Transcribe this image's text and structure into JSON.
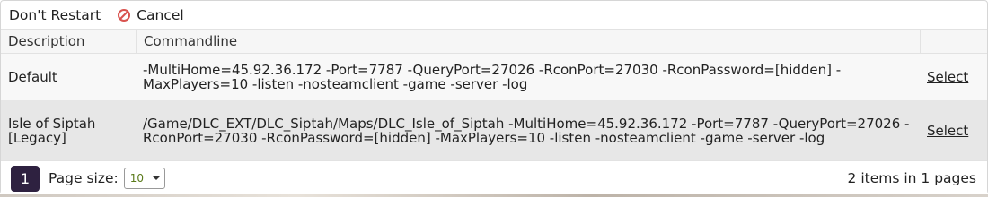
{
  "toolbar": {
    "dont_restart_label": "Don't Restart",
    "cancel_label": "Cancel"
  },
  "table": {
    "headers": [
      "Description",
      "Commandline",
      ""
    ],
    "rows": [
      {
        "description": "Default",
        "commandline": "-MultiHome=45.92.36.172 -Port=7787 -QueryPort=27026 -RconPort=27030 -RconPassword=[hidden] -MaxPlayers=10 -listen -nosteamclient -game -server -log",
        "action": "Select"
      },
      {
        "description": "Isle of Siptah [Legacy]",
        "commandline": "/Game/DLC_EXT/DLC_Siptah/Maps/DLC_Isle_of_Siptah -MultiHome=45.92.36.172 -Port=7787 -QueryPort=27026 -RconPort=27030 -RconPassword=[hidden] -MaxPlayers=10 -listen -nosteamclient -game -server -log",
        "action": "Select"
      }
    ]
  },
  "pager": {
    "current_page": "1",
    "page_size_label": "Page size:",
    "page_size_value": "10",
    "info": "2 items in 1 pages"
  },
  "colors": {
    "accent": "#2e2140",
    "cancel_icon": "#d9534f"
  },
  "icons": {
    "cancel": "cancel-icon",
    "dropdown": "chevron-down-icon"
  }
}
